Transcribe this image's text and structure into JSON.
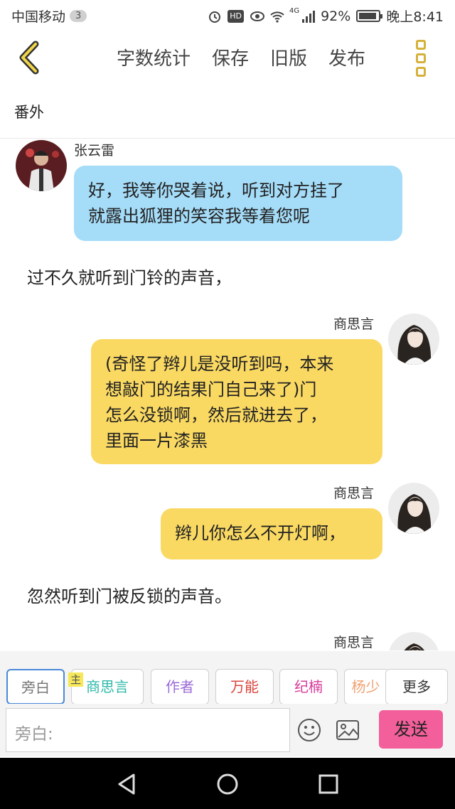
{
  "status_bar": {
    "carrier": "中国移动",
    "notif_count": "3",
    "hd": "HD",
    "network": "4G",
    "battery_pct": "92%",
    "battery_level": 0.92,
    "time": "晚上8:41"
  },
  "toolbar": {
    "word_count": "字数统计",
    "save": "保存",
    "old_version": "旧版",
    "publish": "发布"
  },
  "chapter_title": "番外",
  "messages": [
    {
      "speaker": "张云雷",
      "text_lines": [
        "好，我等你哭着说，听到对方挂了",
        "就露出狐狸的笑容我等着您呢"
      ]
    },
    {
      "narration": "过不久就听到门铃的声音，"
    },
    {
      "speaker": "商思言",
      "text_lines": [
        "(奇怪了辫儿是没听到吗，本来",
        "想敲门的结果门自己来了)门",
        "怎么没锁啊，然后就进去了，",
        "里面一片漆黑"
      ]
    },
    {
      "speaker": "商思言",
      "text_lines": [
        "辫儿你怎么不开灯啊，"
      ]
    },
    {
      "narration": "忽然听到门被反锁的声音。"
    },
    {
      "speaker": "商思言"
    }
  ],
  "roles": {
    "main_tag": "主",
    "items": [
      {
        "label": "旁白",
        "color": "#777777"
      },
      {
        "label": "商思言",
        "color": "#2bb8a8"
      },
      {
        "label": "作者",
        "color": "#9b6bd6"
      },
      {
        "label": "万能",
        "color": "#d9453d"
      },
      {
        "label": "纪楠",
        "color": "#d6399a"
      },
      {
        "label": "杨少",
        "color": "#f0a070"
      }
    ],
    "more": "更多"
  },
  "input": {
    "placeholder": "旁白:"
  },
  "send": "发送"
}
